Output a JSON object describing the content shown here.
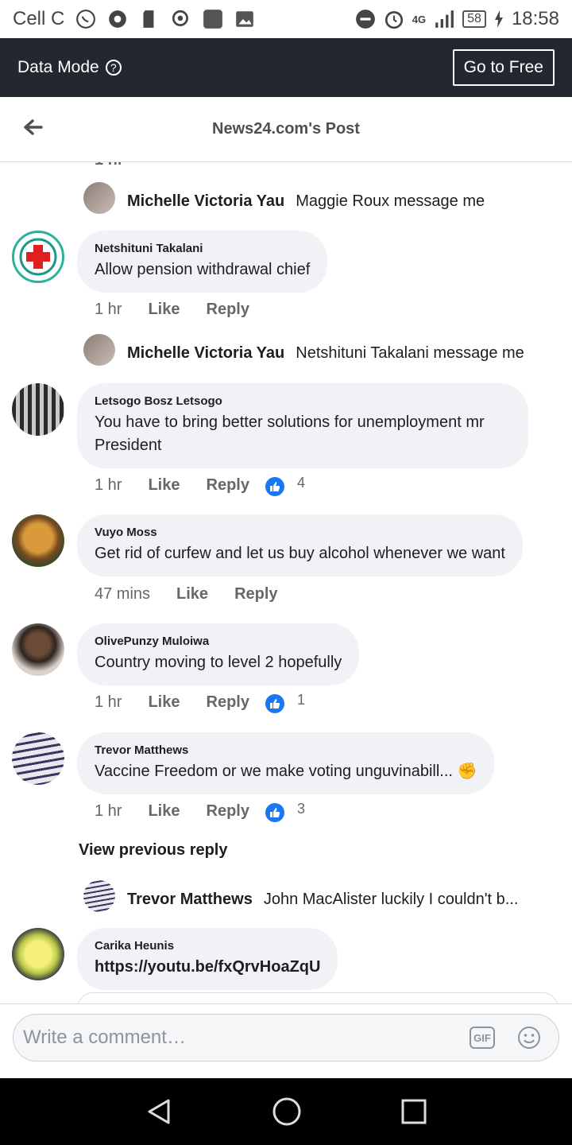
{
  "statusbar": {
    "carrier": "Cell C",
    "network": "4G",
    "battery": "58",
    "time": "18:58",
    "icons": [
      "whatsapp-icon",
      "chrome-icon",
      "sd-card-icon",
      "location-icon",
      "app-icon",
      "gallery-icon",
      "dnd-icon",
      "alarm-icon",
      "signal-icon",
      "charging-icon"
    ]
  },
  "datamode": {
    "label": "Data Mode",
    "help": "?",
    "go_free": "Go to Free"
  },
  "header": {
    "title": "News24.com's Post"
  },
  "replies": {
    "r1": {
      "name": "Michelle Victoria Yau",
      "text": "Maggie Roux message me"
    },
    "r2": {
      "name": "Michelle Victoria Yau",
      "text": "Netshituni Takalani message me"
    },
    "r3": {
      "name": "Trevor Matthews",
      "text": "John MacAlister luckily I couldn't b..."
    }
  },
  "comments": [
    {
      "name": "Netshituni Takalani",
      "text": "Allow pension withdrawal chief",
      "time": "1 hr",
      "like": "Like",
      "reply": "Reply",
      "likes": ""
    },
    {
      "name": "Letsogo Bosz Letsogo",
      "text": "You have to bring better solutions for unemployment mr President",
      "time": "1 hr",
      "like": "Like",
      "reply": "Reply",
      "likes": "4"
    },
    {
      "name": "Vuyo Moss",
      "text": "Get rid of curfew and let us buy alcohol whenever we want",
      "time": "47 mins",
      "like": "Like",
      "reply": "Reply",
      "likes": ""
    },
    {
      "name": "OlivePunzy Muloiwa",
      "text": "Country moving to level 2 hopefully",
      "time": "1 hr",
      "like": "Like",
      "reply": "Reply",
      "likes": "1"
    },
    {
      "name": "Trevor Matthews",
      "text": "Vaccine Freedom or we make voting unguvinabill... ✊",
      "time": "1 hr",
      "like": "Like",
      "reply": "Reply",
      "likes": "3"
    },
    {
      "name": "Carika Heunis",
      "text": "https://youtu.be/fxQrvHoaZqU",
      "time": "",
      "like": "",
      "reply": "",
      "likes": ""
    }
  ],
  "view_previous": "View previous reply",
  "composer": {
    "placeholder": "Write a comment…",
    "gif": "GIF"
  },
  "navbar": {
    "icons": [
      "back-nav-icon",
      "home-nav-icon",
      "recents-nav-icon"
    ]
  },
  "colors": {
    "like_blue": "#1877f2",
    "bubble_bg": "#f0f2f5",
    "topbar": "#23272f"
  }
}
